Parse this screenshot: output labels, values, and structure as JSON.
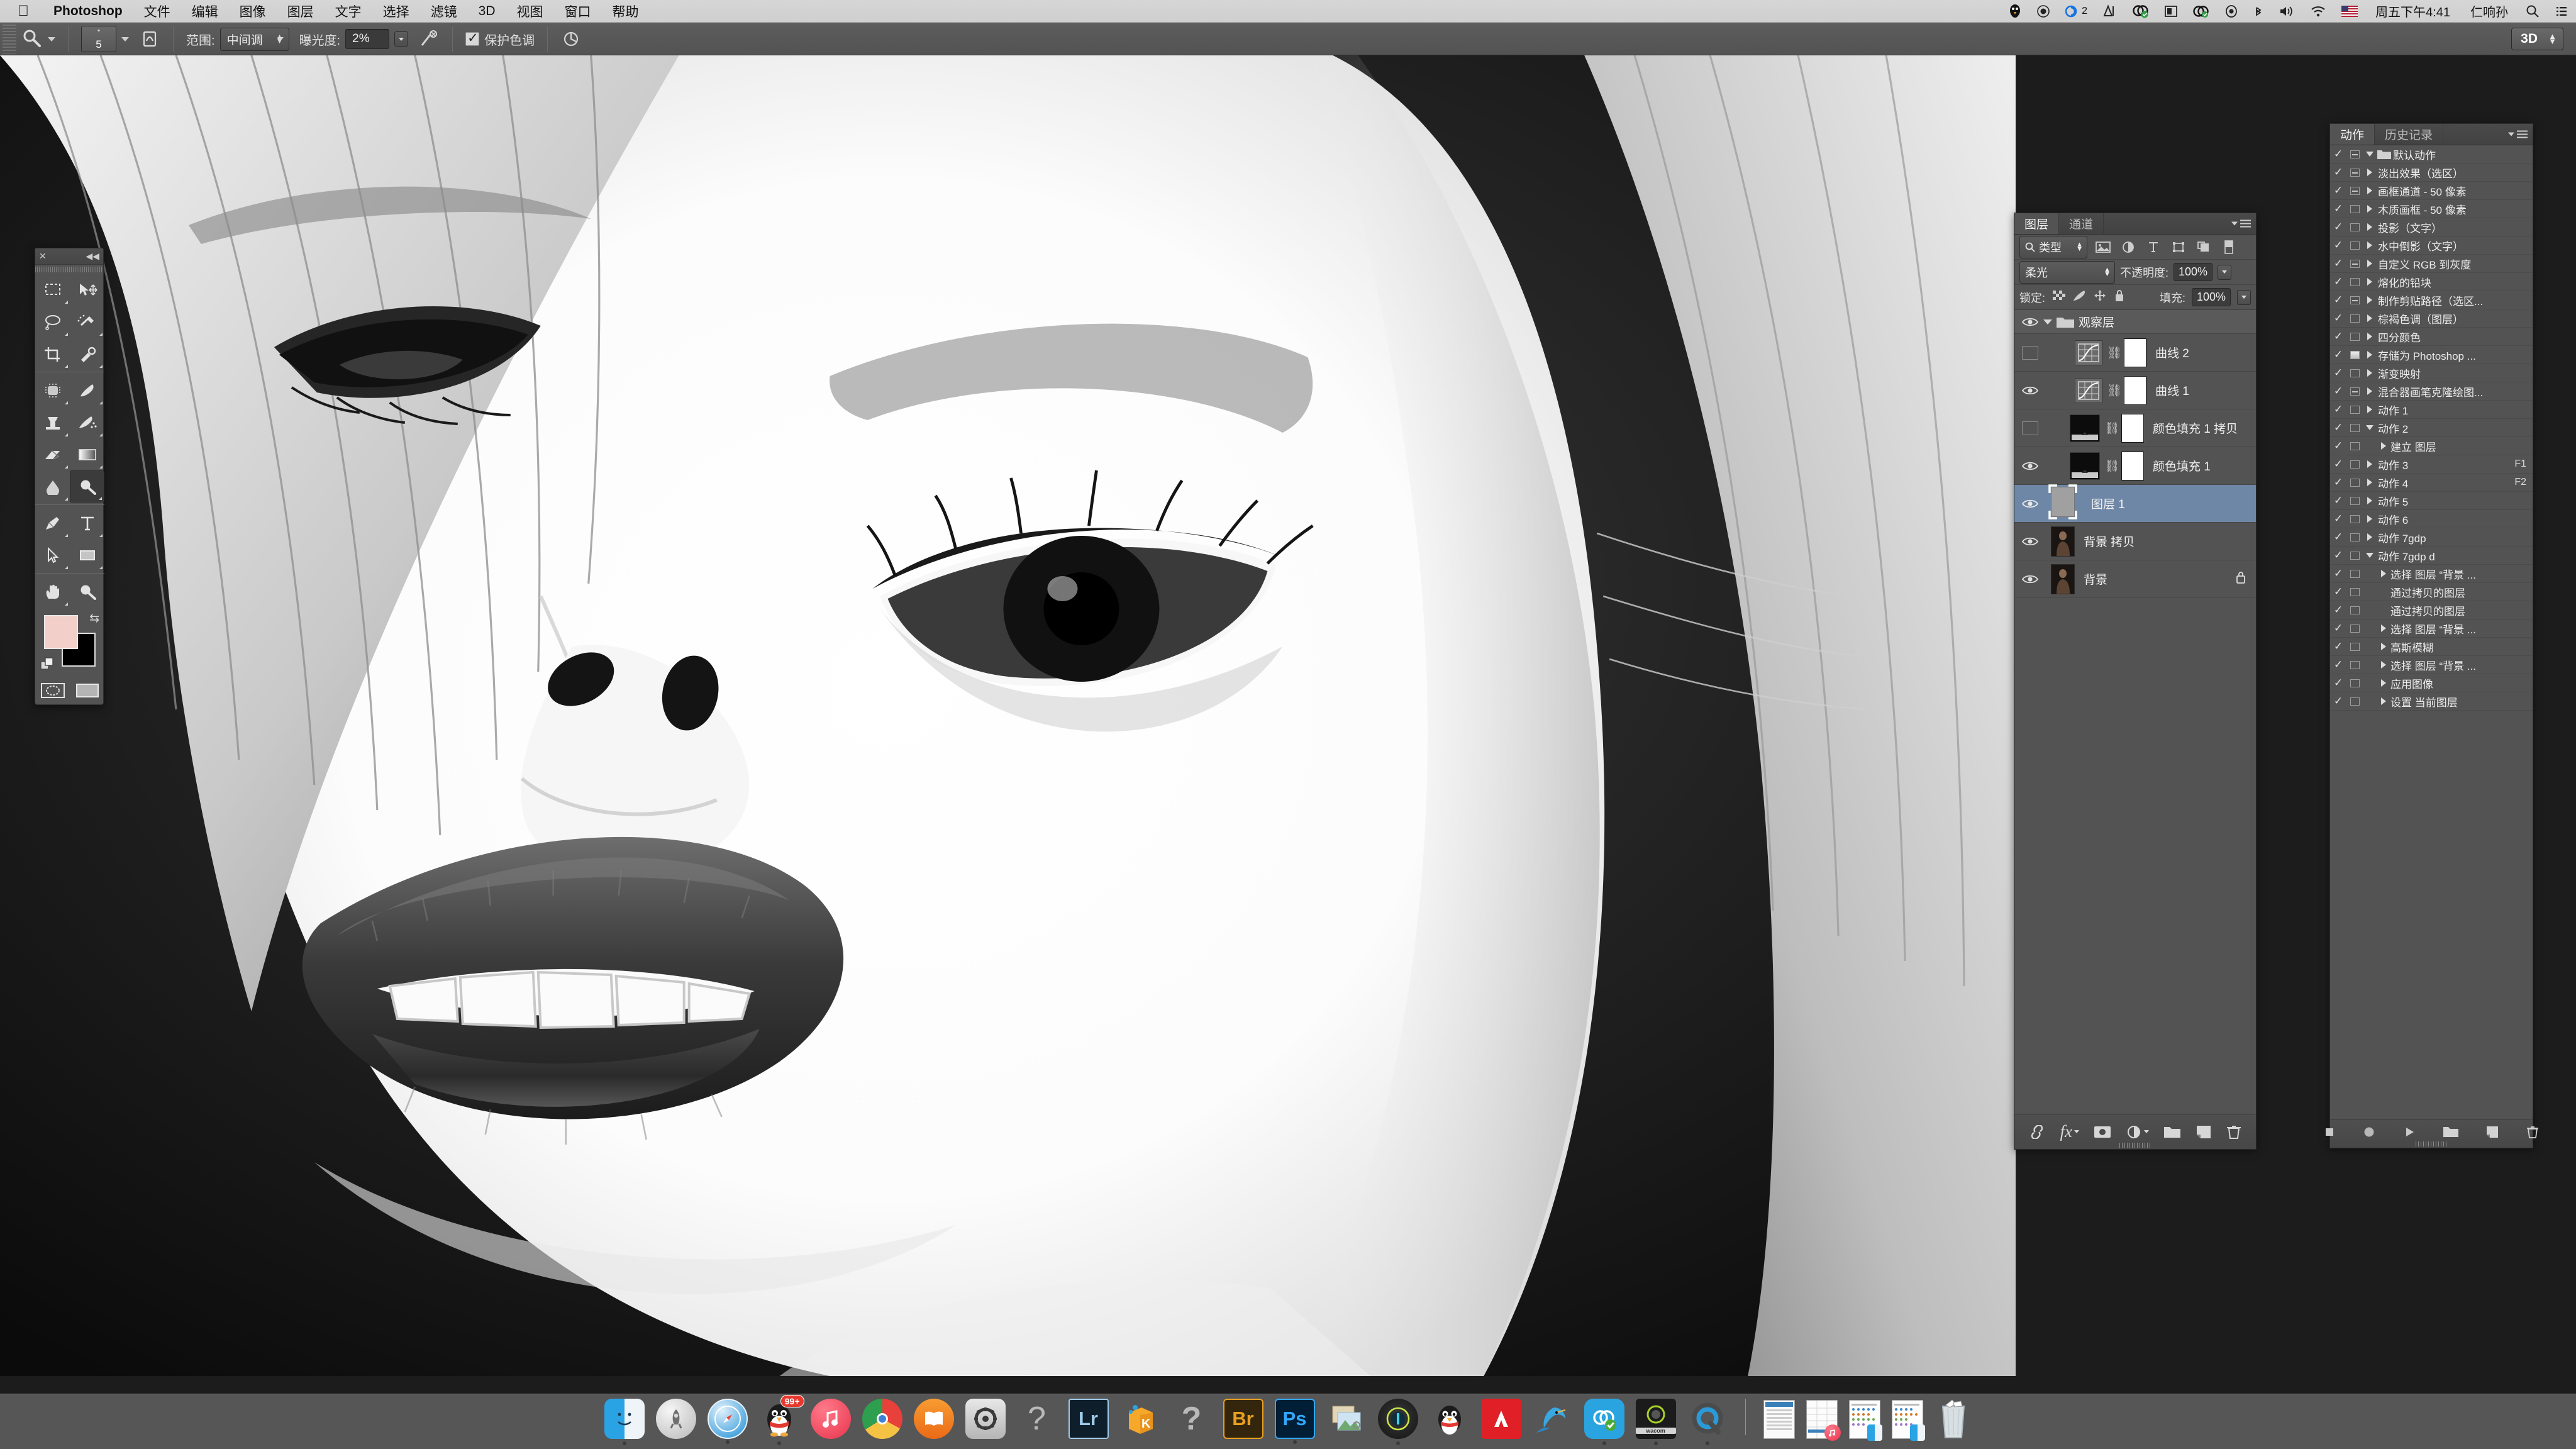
{
  "menubar": {
    "apple": "apple-logo",
    "items": [
      "Photoshop",
      "文件",
      "编辑",
      "图像",
      "图层",
      "文字",
      "选择",
      "滤镜",
      "3D",
      "视图",
      "窗口",
      "帮助"
    ],
    "status_icons": [
      "penguin-qq-icon",
      "record-icon",
      "creative-cloud-icon",
      "app-icon",
      "dropbox-icon",
      "display-icon",
      "sync-icon",
      "shield-icon",
      "bluetooth-icon",
      "volume-icon",
      "wifi-icon",
      "flag-icon"
    ],
    "cc_badge": "2",
    "clock": "周五下午4:41",
    "user": "仁响孙",
    "search_icon": "search-icon",
    "notification_icon": "notification-center-icon"
  },
  "optionsbar": {
    "tool_icon": "dodge-tool-icon",
    "brush_preset_number": "5",
    "brush_panel_icon": "brush-panel-icon",
    "range_label": "范围:",
    "range_value": "中间调",
    "exposure_label": "曝光度:",
    "exposure_value": "2%",
    "airbrush_icon": "airbrush-icon",
    "protect_tones_label": "保护色调",
    "protect_tones_checked": true,
    "tablet_pressure_icon": "tablet-pressure-icon",
    "workspace": "3D"
  },
  "tools": {
    "close_icon": "close-icon",
    "collapse_icon": "collapse-icon",
    "items": [
      "marquee-tool",
      "move-tool",
      "lasso-tool",
      "quick-selection-tool",
      "crop-tool",
      "eyedropper-tool",
      "healing-brush-tool",
      "brush-tool",
      "clone-stamp-tool",
      "history-brush-tool",
      "eraser-tool",
      "gradient-tool",
      "blur-tool",
      "dodge-tool",
      "pen-tool",
      "type-tool",
      "path-selection-tool",
      "rectangle-tool",
      "hand-tool",
      "zoom-tool"
    ],
    "selected": "dodge-tool",
    "foreground_color": "#f2cfc9",
    "background_color": "#000000",
    "swap_icon": "swap-colors-icon",
    "default_colors_icon": "default-colors-icon",
    "quick_mask_icon": "quick-mask-icon",
    "screen_mode_icon": "screen-mode-icon"
  },
  "layers_panel": {
    "tabs": [
      {
        "label": "图层",
        "active": true
      },
      {
        "label": "通道",
        "active": false
      }
    ],
    "menu_icon": "panel-menu-icon",
    "filter_label": "类型",
    "filter_icon": "search-icon",
    "filter_type_icons": [
      "pixel-filter-icon",
      "adjustment-filter-icon",
      "type-filter-icon",
      "shape-filter-icon",
      "smartobject-filter-icon"
    ],
    "filter_toggle_icon": "filter-toggle-icon",
    "blend_mode": "柔光",
    "opacity_label": "不透明度:",
    "opacity_value": "100%",
    "lock_label": "锁定:",
    "lock_icons": [
      "lock-transparent-icon",
      "lock-image-icon",
      "lock-position-icon",
      "lock-all-icon"
    ],
    "fill_label": "填充:",
    "fill_value": "100%",
    "rows": [
      {
        "name": "观察层",
        "kind": "group",
        "visible": true,
        "expanded": true,
        "selected": false,
        "locked": false
      },
      {
        "name": "曲线 2",
        "kind": "adjustment",
        "visible": false,
        "selected": false,
        "locked": false
      },
      {
        "name": "曲线 1",
        "kind": "adjustment",
        "visible": true,
        "selected": false,
        "locked": false
      },
      {
        "name": "颜色填充 1 拷贝",
        "kind": "solid",
        "visible": false,
        "selected": false,
        "locked": false
      },
      {
        "name": "颜色填充 1",
        "kind": "solid",
        "visible": true,
        "selected": false,
        "locked": false
      },
      {
        "name": "图层 1",
        "kind": "pixel-empty",
        "visible": true,
        "selected": true,
        "locked": false
      },
      {
        "name": "背景 拷贝",
        "kind": "pixel-photo",
        "visible": true,
        "selected": false,
        "locked": false
      },
      {
        "name": "背景",
        "kind": "pixel-photo",
        "visible": true,
        "selected": false,
        "locked": true
      }
    ],
    "footer_icons": [
      "link-layers-icon",
      "layer-style-fx-icon",
      "add-mask-icon",
      "new-adjustment-icon",
      "new-group-icon",
      "new-layer-icon",
      "delete-layer-icon"
    ]
  },
  "actions_panel": {
    "tabs": [
      {
        "label": "动作",
        "active": true
      },
      {
        "label": "历史记录",
        "active": false
      }
    ],
    "menu_icon": "panel-menu-icon",
    "rows": [
      {
        "name": "默认动作",
        "checked": true,
        "box": "dash",
        "twirl": "down",
        "indent": 0,
        "folder": true,
        "key": ""
      },
      {
        "name": "淡出效果（选区）",
        "checked": true,
        "box": "dash",
        "twirl": "right",
        "indent": 1,
        "key": ""
      },
      {
        "name": "画框通道 - 50 像素",
        "checked": true,
        "box": "dash",
        "twirl": "right",
        "indent": 1,
        "key": ""
      },
      {
        "name": "木质画框 - 50 像素",
        "checked": true,
        "box": "empty",
        "twirl": "right",
        "indent": 1,
        "key": ""
      },
      {
        "name": "投影（文字）",
        "checked": true,
        "box": "empty",
        "twirl": "right",
        "indent": 1,
        "key": ""
      },
      {
        "name": "水中倒影（文字）",
        "checked": true,
        "box": "empty",
        "twirl": "right",
        "indent": 1,
        "key": ""
      },
      {
        "name": "自定义 RGB 到灰度",
        "checked": true,
        "box": "dash",
        "twirl": "right",
        "indent": 1,
        "key": ""
      },
      {
        "name": "熔化的铅块",
        "checked": true,
        "box": "empty",
        "twirl": "right",
        "indent": 1,
        "key": ""
      },
      {
        "name": "制作剪贴路径（选区...",
        "checked": true,
        "box": "dash",
        "twirl": "right",
        "indent": 1,
        "key": ""
      },
      {
        "name": "棕褐色调（图层）",
        "checked": true,
        "box": "empty",
        "twirl": "right",
        "indent": 1,
        "key": ""
      },
      {
        "name": "四分颜色",
        "checked": true,
        "box": "empty",
        "twirl": "right",
        "indent": 1,
        "key": ""
      },
      {
        "name": "存储为 Photoshop ...",
        "checked": true,
        "box": "full",
        "twirl": "right",
        "indent": 1,
        "key": ""
      },
      {
        "name": "渐变映射",
        "checked": true,
        "box": "empty",
        "twirl": "right",
        "indent": 1,
        "key": ""
      },
      {
        "name": "混合器画笔克隆绘图...",
        "checked": true,
        "box": "dash",
        "twirl": "right",
        "indent": 1,
        "key": ""
      },
      {
        "name": "动作 1",
        "checked": true,
        "box": "empty",
        "twirl": "right",
        "indent": 1,
        "key": ""
      },
      {
        "name": "动作 2",
        "checked": true,
        "box": "empty",
        "twirl": "down",
        "indent": 1,
        "key": ""
      },
      {
        "name": "建立 图层",
        "checked": true,
        "box": "empty",
        "twirl": "right",
        "indent": 2,
        "key": ""
      },
      {
        "name": "动作 3",
        "checked": true,
        "box": "empty",
        "twirl": "right",
        "indent": 1,
        "key": "F1"
      },
      {
        "name": "动作 4",
        "checked": true,
        "box": "empty",
        "twirl": "right",
        "indent": 1,
        "key": "F2"
      },
      {
        "name": "动作 5",
        "checked": true,
        "box": "empty",
        "twirl": "right",
        "indent": 1,
        "key": ""
      },
      {
        "name": "动作 6",
        "checked": true,
        "box": "empty",
        "twirl": "right",
        "indent": 1,
        "key": ""
      },
      {
        "name": "动作 7gdp",
        "checked": true,
        "box": "empty",
        "twirl": "right",
        "indent": 1,
        "key": ""
      },
      {
        "name": "动作 7gdp d",
        "checked": true,
        "box": "empty",
        "twirl": "down",
        "indent": 1,
        "key": ""
      },
      {
        "name": "选择 图层 “背景 ...",
        "checked": true,
        "box": "empty",
        "twirl": "right",
        "indent": 2,
        "key": ""
      },
      {
        "name": "通过拷贝的图层",
        "checked": true,
        "box": "empty",
        "twirl": "none",
        "indent": 2,
        "key": ""
      },
      {
        "name": "通过拷贝的图层",
        "checked": true,
        "box": "empty",
        "twirl": "none",
        "indent": 2,
        "key": ""
      },
      {
        "name": "选择 图层 “背景 ...",
        "checked": true,
        "box": "empty",
        "twirl": "right",
        "indent": 2,
        "key": ""
      },
      {
        "name": "高斯模糊",
        "checked": true,
        "box": "empty",
        "twirl": "right",
        "indent": 2,
        "key": ""
      },
      {
        "name": "选择 图层 “背景 ...",
        "checked": true,
        "box": "empty",
        "twirl": "right",
        "indent": 2,
        "key": ""
      },
      {
        "name": "应用图像",
        "checked": true,
        "box": "empty",
        "twirl": "right",
        "indent": 2,
        "key": ""
      },
      {
        "name": "设置 当前图层",
        "checked": true,
        "box": "empty",
        "twirl": "right",
        "indent": 2,
        "key": ""
      }
    ],
    "footer_icons": [
      "stop-recording-icon",
      "record-icon",
      "play-icon",
      "new-set-icon",
      "new-action-icon",
      "delete-action-icon"
    ]
  },
  "dock": {
    "items": [
      {
        "name": "finder-icon",
        "label": "Finder",
        "running": true,
        "badge": ""
      },
      {
        "name": "launchpad-icon",
        "label": "Launchpad",
        "running": false,
        "badge": ""
      },
      {
        "name": "safari-icon",
        "label": "Safari",
        "running": true,
        "badge": ""
      },
      {
        "name": "qq-icon",
        "label": "QQ",
        "running": true,
        "badge": "99+"
      },
      {
        "name": "itunes-icon",
        "label": "iTunes",
        "running": false,
        "badge": ""
      },
      {
        "name": "chrome-icon",
        "label": "Chrome",
        "running": false,
        "badge": ""
      },
      {
        "name": "ibooks-icon",
        "label": "iBooks",
        "running": false,
        "badge": ""
      },
      {
        "name": "system-preferences-icon",
        "label": "System Preferences",
        "running": false,
        "badge": ""
      },
      {
        "name": "help-icon",
        "label": "Help",
        "running": false,
        "badge": ""
      },
      {
        "name": "lightroom-icon",
        "label": "Lr",
        "running": false,
        "badge": ""
      },
      {
        "name": "kmplayer-icon",
        "label": "KMPlayer",
        "running": false,
        "badge": ""
      },
      {
        "name": "help-icon-2",
        "label": "Help",
        "running": false,
        "badge": ""
      },
      {
        "name": "bridge-icon",
        "label": "Br",
        "running": false,
        "badge": ""
      },
      {
        "name": "photoshop-icon",
        "label": "Ps",
        "running": true,
        "badge": ""
      },
      {
        "name": "preview-icon",
        "label": "Preview",
        "running": false,
        "badge": ""
      },
      {
        "name": "capture-one-icon",
        "label": "Capture One",
        "running": true,
        "badge": ""
      },
      {
        "name": "qq-icon-2",
        "label": "QQ",
        "running": false,
        "badge": ""
      },
      {
        "name": "adobe-icon",
        "label": "Adobe",
        "running": false,
        "badge": ""
      },
      {
        "name": "hummingbird-icon",
        "label": "Hummingbird",
        "running": false,
        "badge": ""
      },
      {
        "name": "sync-icon",
        "label": "Sync",
        "running": true,
        "badge": ""
      },
      {
        "name": "wacom-icon",
        "label": "Wacom",
        "running": true,
        "badge": ""
      },
      {
        "name": "quicktime-icon",
        "label": "QuickTime",
        "running": true,
        "badge": ""
      }
    ],
    "minimized": [
      "minimized-qq-window",
      "minimized-itunes-window",
      "minimized-finder-window-1",
      "minimized-finder-window-2"
    ],
    "trash": "trash-icon"
  },
  "canvas": {
    "document_description": "黑白人像特写（闭眼、张嘴）",
    "zoom_tool_active": true
  }
}
